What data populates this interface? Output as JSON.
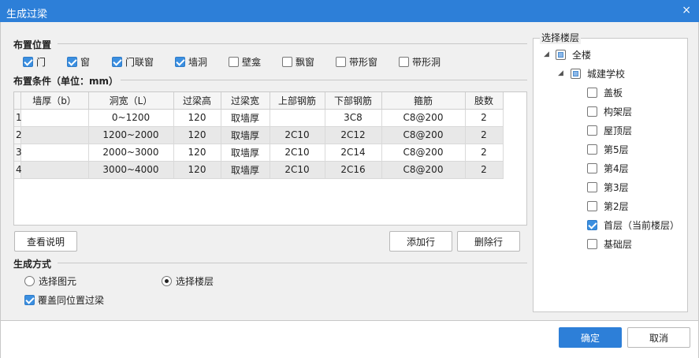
{
  "window": {
    "title": "生成过梁",
    "close": "×"
  },
  "layout_section": {
    "title": "布置位置",
    "options": [
      {
        "label": "门",
        "checked": true
      },
      {
        "label": "窗",
        "checked": true
      },
      {
        "label": "门联窗",
        "checked": true
      },
      {
        "label": "墙洞",
        "checked": true
      },
      {
        "label": "壁龛",
        "checked": false
      },
      {
        "label": "飘窗",
        "checked": false
      },
      {
        "label": "带形窗",
        "checked": false
      },
      {
        "label": "带形洞",
        "checked": false
      }
    ]
  },
  "condition_section": {
    "title": "布置条件（单位：mm）"
  },
  "table": {
    "headers": [
      "墙厚（b）",
      "洞宽（L）",
      "过梁高",
      "过梁宽",
      "上部钢筋",
      "下部钢筋",
      "箍筋",
      "肢数"
    ],
    "rows": [
      {
        "num": "1",
        "cells": [
          "",
          "0~1200",
          "120",
          "取墙厚",
          "",
          "3C8",
          "C8@200",
          "2"
        ]
      },
      {
        "num": "2",
        "cells": [
          "",
          "1200~2000",
          "120",
          "取墙厚",
          "2C10",
          "2C12",
          "C8@200",
          "2"
        ]
      },
      {
        "num": "3",
        "cells": [
          "",
          "2000~3000",
          "120",
          "取墙厚",
          "2C10",
          "2C14",
          "C8@200",
          "2"
        ]
      },
      {
        "num": "4",
        "cells": [
          "",
          "3000~4000",
          "120",
          "取墙厚",
          "2C10",
          "2C16",
          "C8@200",
          "2"
        ]
      }
    ]
  },
  "buttons": {
    "view_help": "查看说明",
    "add_row": "添加行",
    "delete_row": "删除行",
    "ok": "确定",
    "cancel": "取消"
  },
  "generate_section": {
    "title": "生成方式",
    "radio_select_element": "选择图元",
    "radio_select_floor": "选择楼层",
    "selected": "选择楼层",
    "overwrite_label": "覆盖同位置过梁",
    "overwrite_checked": true
  },
  "floors": {
    "title": "选择楼层",
    "root": "全楼",
    "project": "城建学校",
    "items": [
      {
        "label": "盖板",
        "checked": false
      },
      {
        "label": "构架层",
        "checked": false
      },
      {
        "label": "屋顶层",
        "checked": false
      },
      {
        "label": "第5层",
        "checked": false
      },
      {
        "label": "第4层",
        "checked": false
      },
      {
        "label": "第3层",
        "checked": false
      },
      {
        "label": "第2层",
        "checked": false
      },
      {
        "label": "首层（当前楼层）",
        "checked": true
      },
      {
        "label": "基础层",
        "checked": false
      }
    ]
  },
  "colors": {
    "accent": "#2d7fd8",
    "check": "#3b8fe0"
  }
}
